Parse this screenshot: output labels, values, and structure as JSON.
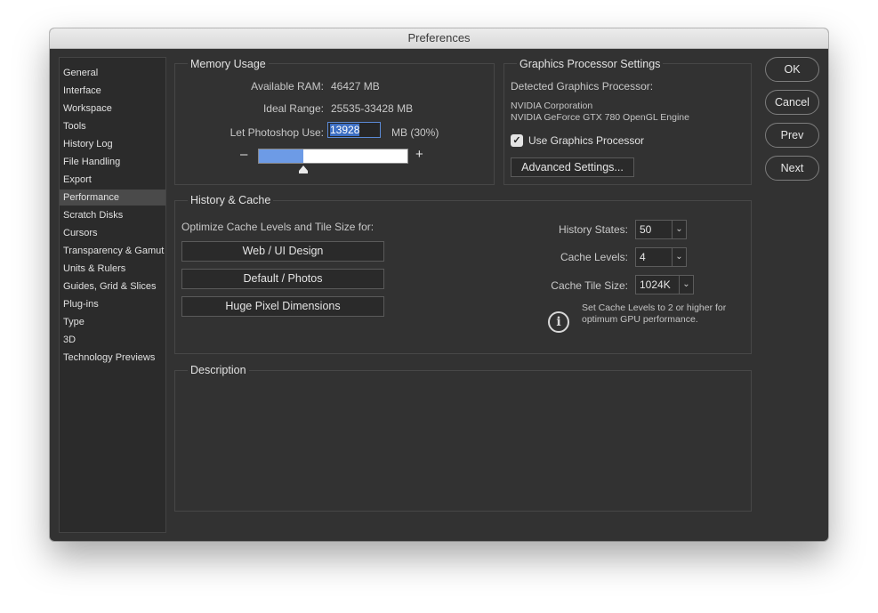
{
  "window": {
    "title": "Preferences"
  },
  "sidebar": {
    "items": [
      {
        "label": "General"
      },
      {
        "label": "Interface"
      },
      {
        "label": "Workspace"
      },
      {
        "label": "Tools"
      },
      {
        "label": "History Log"
      },
      {
        "label": "File Handling"
      },
      {
        "label": "Export"
      },
      {
        "label": "Performance",
        "active": true
      },
      {
        "label": "Scratch Disks"
      },
      {
        "label": "Cursors"
      },
      {
        "label": "Transparency & Gamut"
      },
      {
        "label": "Units & Rulers"
      },
      {
        "label": "Guides, Grid & Slices"
      },
      {
        "label": "Plug-ins"
      },
      {
        "label": "Type"
      },
      {
        "label": "3D"
      },
      {
        "label": "Technology Previews"
      }
    ]
  },
  "memory": {
    "title": "Memory Usage",
    "available_label": "Available RAM:",
    "available_value": "46427 MB",
    "ideal_label": "Ideal Range:",
    "ideal_value": "25535-33428 MB",
    "use_label": "Let Photoshop Use:",
    "use_value": "13928",
    "use_suffix": "MB (30%)",
    "minus": "–",
    "plus": "+",
    "slider_fraction": 0.3
  },
  "gpu": {
    "title": "Graphics Processor Settings",
    "detected_label": "Detected Graphics Processor:",
    "vendor": "NVIDIA Corporation",
    "device": "NVIDIA GeForce GTX 780 OpenGL Engine",
    "use_label": "Use Graphics Processor",
    "use_checked": true,
    "checkmark": "✓",
    "advanced_button": "Advanced Settings..."
  },
  "history_cache": {
    "title": "History & Cache",
    "optimize_label": "Optimize Cache Levels and Tile Size for:",
    "buttons": [
      "Web / UI Design",
      "Default / Photos",
      "Huge Pixel Dimensions"
    ],
    "history_states_label": "History States:",
    "history_states_value": "50",
    "cache_levels_label": "Cache Levels:",
    "cache_levels_value": "4",
    "tile_size_label": "Cache Tile Size:",
    "tile_size_value": "1024K",
    "info_line1": "Set Cache Levels to 2 or higher for",
    "info_line2": "optimum GPU performance.",
    "info_glyph": "i",
    "chevron": "⌄"
  },
  "description": {
    "title": "Description"
  },
  "actions": {
    "ok": "OK",
    "cancel": "Cancel",
    "prev": "Prev",
    "next": "Next"
  }
}
